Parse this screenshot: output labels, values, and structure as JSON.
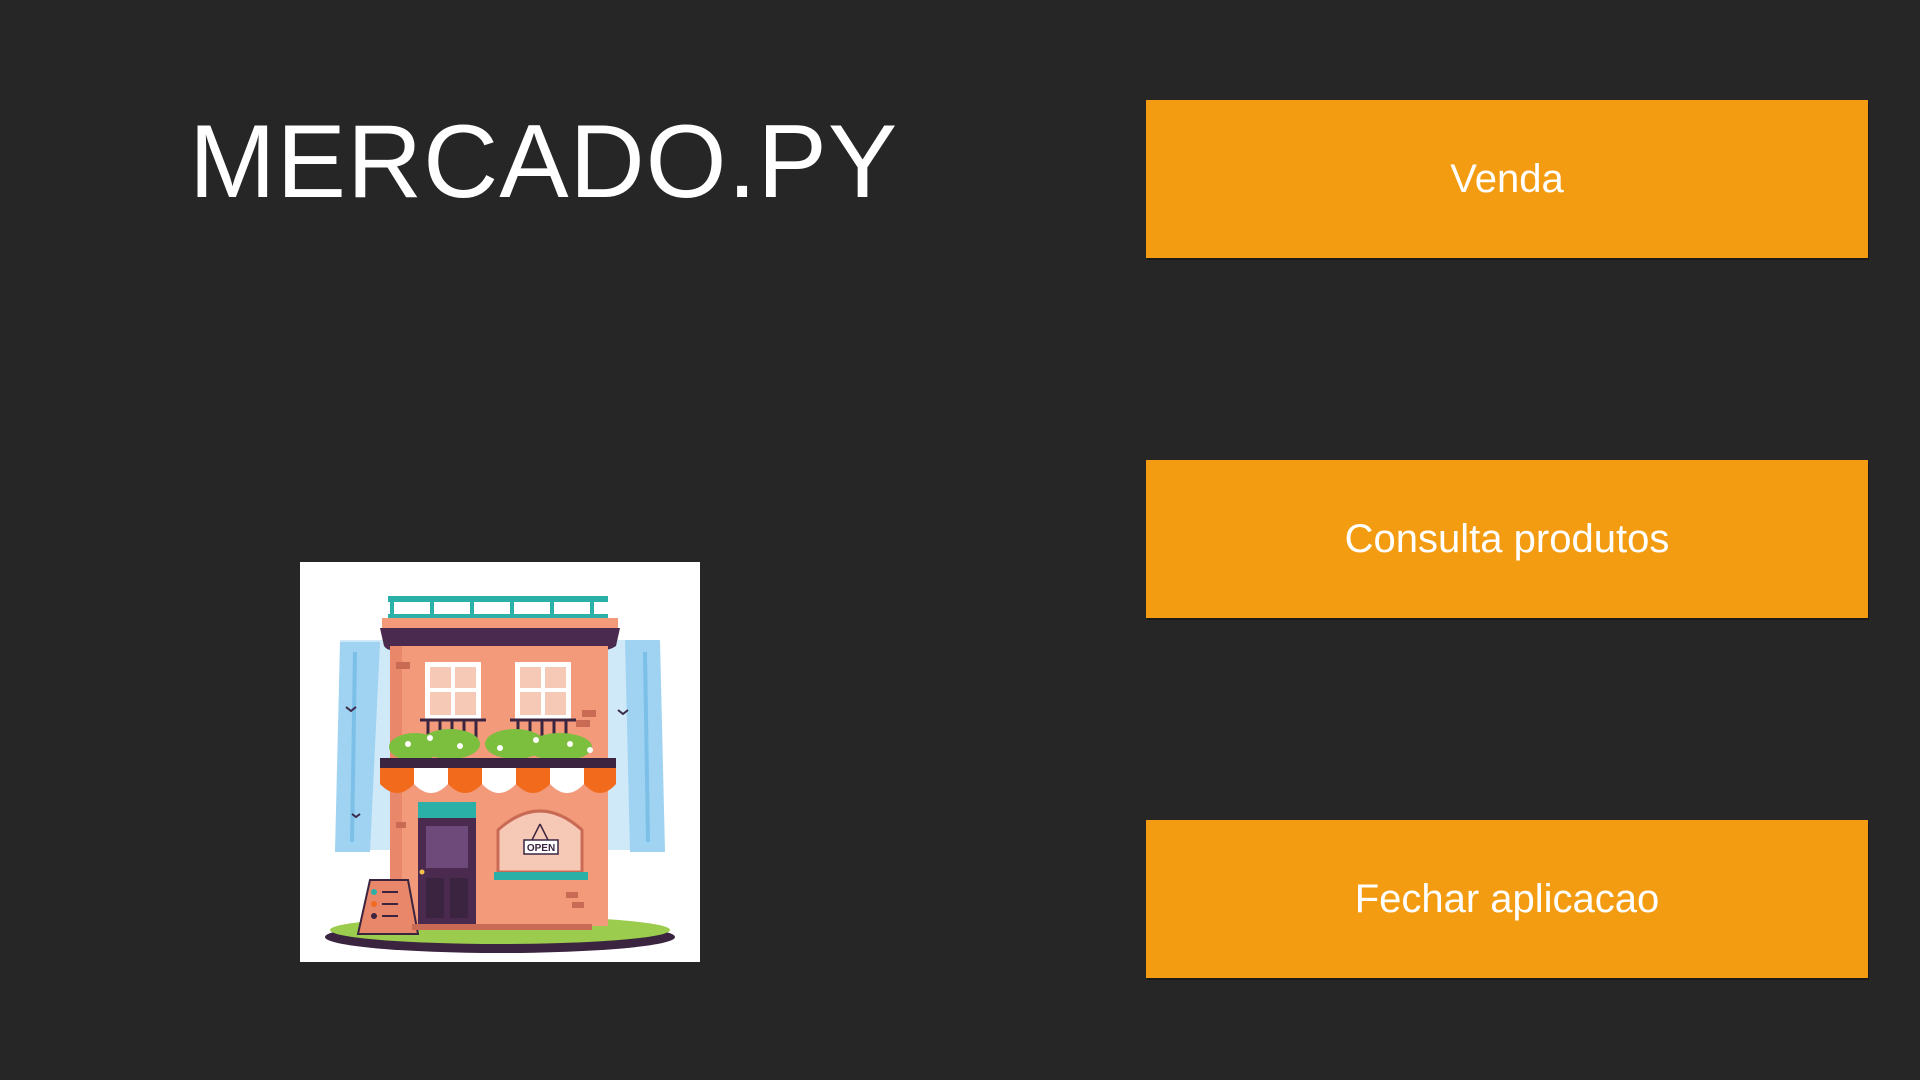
{
  "app": {
    "title": "MERCADO.PY"
  },
  "menu": {
    "venda_label": "Venda",
    "consulta_label": "Consulta produtos",
    "fechar_label": "Fechar aplicacao"
  },
  "logo": {
    "sign_text": "OPEN",
    "icon": "storefront-illustration"
  },
  "colors": {
    "background": "#262626",
    "accent": "#f39c12",
    "text": "#ffffff"
  }
}
